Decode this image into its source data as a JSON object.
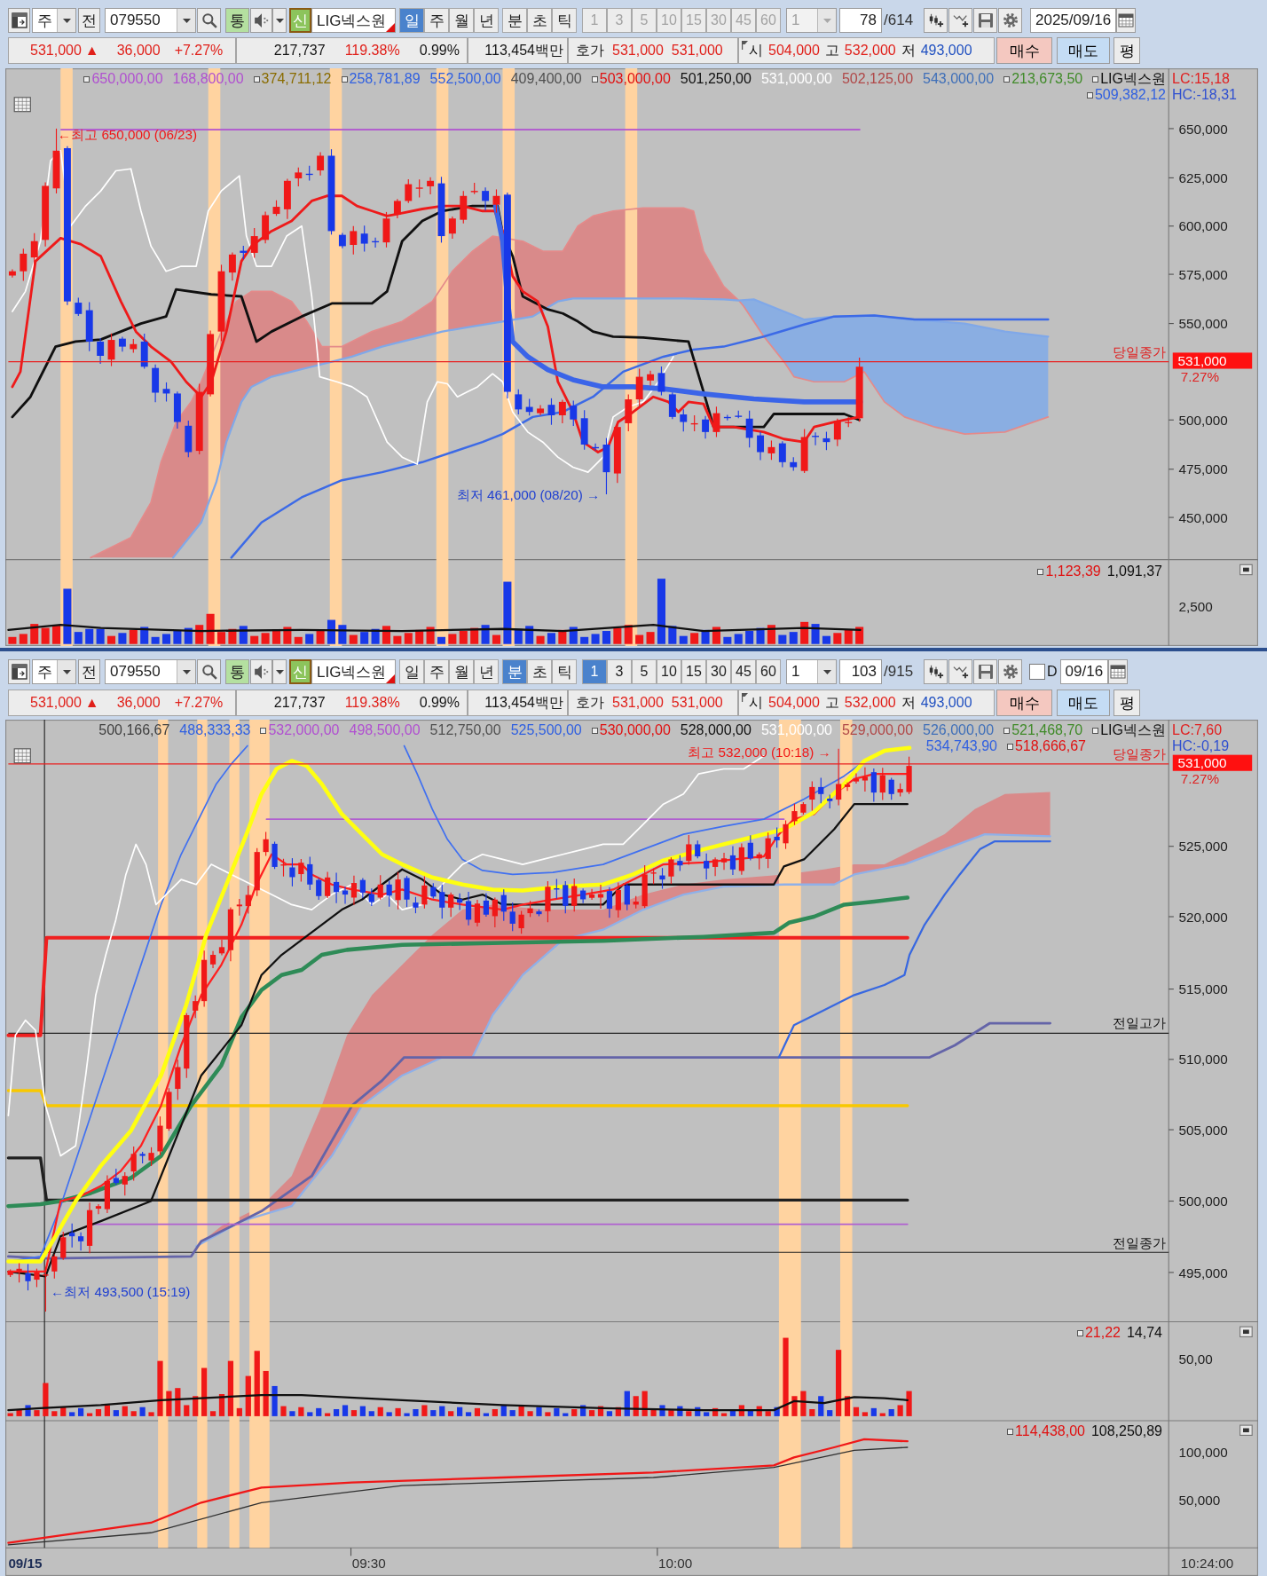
{
  "panels": [
    {
      "toolbar": {
        "unit": "주",
        "prev": "전",
        "code": "079550",
        "volume": "통",
        "credit": "신",
        "name": "LIG넥스원",
        "periods": [
          {
            "label": "일",
            "selected": true
          },
          {
            "label": "주",
            "selected": false
          },
          {
            "label": "월",
            "selected": false
          },
          {
            "label": "년",
            "selected": false
          }
        ],
        "intervals": [
          {
            "label": "분",
            "selected": false
          },
          {
            "label": "초",
            "selected": false
          },
          {
            "label": "틱",
            "selected": false
          }
        ],
        "steps": [
          {
            "label": "1",
            "selected": false,
            "disabled": true
          },
          {
            "label": "3",
            "selected": false,
            "disabled": true
          },
          {
            "label": "5",
            "selected": false,
            "disabled": true
          },
          {
            "label": "10",
            "selected": false,
            "disabled": true
          },
          {
            "label": "15",
            "selected": false,
            "disabled": true
          },
          {
            "label": "30",
            "selected": false,
            "disabled": true
          },
          {
            "label": "45",
            "selected": false,
            "disabled": true
          },
          {
            "label": "60",
            "selected": false,
            "disabled": true
          }
        ],
        "multiplier": {
          "value": "1",
          "disabled": true
        },
        "count": "78",
        "total": "/614",
        "date": "2025/09/16"
      },
      "quote": {
        "price": "531,000",
        "arrow": "▲",
        "change": "36,000",
        "rate": "+7.27%",
        "volume": "217,737",
        "volume_rate": "119.38%",
        "turnover": "0.99%",
        "amount": "113,454백만",
        "ask_label": "호가",
        "ask": "531,000",
        "bid": "531,000",
        "open_label": "시",
        "open": "504,000",
        "high_label": "고",
        "high": "532,000",
        "low_label": "저",
        "low": "493,000",
        "buy": "매수",
        "sell": "매도",
        "avg": "평"
      },
      "chart": {
        "kind": "daily",
        "legend": {
          "lines": [
            {
              "items": [
                {
                  "text": "650,000,00",
                  "color": "#b050d0",
                  "marker": true
                },
                {
                  "text": "168,800,00",
                  "color": "#b050d0",
                  "marker": false
                },
                {
                  "text": "374,711,12",
                  "color": "#8a6c00",
                  "marker": true
                },
                {
                  "text": "258,781,89",
                  "color": "#3060e0",
                  "marker": true
                },
                {
                  "text": "552,500,00",
                  "color": "#3060e0",
                  "marker": false
                },
                {
                  "text": "409,400,00",
                  "color": "#505050",
                  "marker": false
                },
                {
                  "text": "503,000,00",
                  "color": "#e01010",
                  "marker": true
                },
                {
                  "text": "501,250,00",
                  "color": "#101010",
                  "marker": false
                },
                {
                  "text": "531,000,00",
                  "color": "#ffffff",
                  "marker": false
                },
                {
                  "text": "502,125,00",
                  "color": "#b04848",
                  "marker": false
                },
                {
                  "text": "543,000,00",
                  "color": "#3f6fb8",
                  "marker": false
                },
                {
                  "text": "213,673,50",
                  "color": "#3f8a28",
                  "marker": true
                },
                {
                  "text": "LIG넥스원",
                  "color": "#101010",
                  "marker": true
                }
              ]
            },
            {
              "items": [
                {
                  "text": "509,382,12",
                  "color": "#3060e0",
                  "marker": true
                }
              ]
            }
          ],
          "lc": "LC:15,18",
          "hc": "HC:-18,31"
        },
        "price_axis": [
          "650,000",
          "625,000",
          "600,000",
          "575,000",
          "550,000",
          "500,000",
          "475,000",
          "450,000"
        ],
        "close": {
          "label": "당일종가",
          "price": "531,000",
          "rate": "7.27%"
        },
        "annotations": [
          {
            "kind": "high",
            "text": "←최고 650,000 (06/23)"
          },
          {
            "kind": "low",
            "text": "최저 461,000 (08/20) →"
          }
        ],
        "panes": [
          {
            "legend": [
              {
                "text": "1,123,39",
                "color": "#e01010",
                "marker": true
              },
              {
                "text": "1,091,37",
                "color": "#101010",
                "marker": false
              }
            ],
            "axis": [
              "2,500"
            ]
          }
        ]
      }
    },
    {
      "toolbar": {
        "unit": "주",
        "prev": "전",
        "code": "079550",
        "volume": "통",
        "credit": "신",
        "name": "LIG넥스원",
        "periods": [
          {
            "label": "일",
            "selected": false
          },
          {
            "label": "주",
            "selected": false
          },
          {
            "label": "월",
            "selected": false
          },
          {
            "label": "년",
            "selected": false
          }
        ],
        "intervals": [
          {
            "label": "분",
            "selected": true
          },
          {
            "label": "초",
            "selected": false
          },
          {
            "label": "틱",
            "selected": false
          }
        ],
        "steps": [
          {
            "label": "1",
            "selected": true,
            "disabled": false
          },
          {
            "label": "3",
            "selected": false,
            "disabled": false
          },
          {
            "label": "5",
            "selected": false,
            "disabled": false
          },
          {
            "label": "10",
            "selected": false,
            "disabled": false
          },
          {
            "label": "15",
            "selected": false,
            "disabled": false
          },
          {
            "label": "30",
            "selected": false,
            "disabled": false
          },
          {
            "label": "45",
            "selected": false,
            "disabled": false
          },
          {
            "label": "60",
            "selected": false,
            "disabled": false
          }
        ],
        "multiplier": {
          "value": "1",
          "disabled": false
        },
        "count": "103",
        "total": "/915",
        "date_filter": {
          "label": "D",
          "checked": false
        },
        "date": "09/16"
      },
      "quote": {
        "price": "531,000",
        "arrow": "▲",
        "change": "36,000",
        "rate": "+7.27%",
        "volume": "217,737",
        "volume_rate": "119.38%",
        "turnover": "0.99%",
        "amount": "113,454백만",
        "ask_label": "호가",
        "ask": "531,000",
        "bid": "531,000",
        "open_label": "시",
        "open": "504,000",
        "high_label": "고",
        "high": "532,000",
        "low_label": "저",
        "low": "493,000",
        "buy": "매수",
        "sell": "매도",
        "avg": "평"
      },
      "chart": {
        "kind": "intraday",
        "legend": {
          "lines": [
            {
              "items": [
                {
                  "text": "500,166,67",
                  "color": "#404040",
                  "marker": false
                },
                {
                  "text": "488,333,33",
                  "color": "#3060e0",
                  "marker": false
                },
                {
                  "text": "532,000,00",
                  "color": "#b050d0",
                  "marker": true
                },
                {
                  "text": "498,500,00",
                  "color": "#b050d0",
                  "marker": false
                },
                {
                  "text": "512,750,00",
                  "color": "#505050",
                  "marker": false
                },
                {
                  "text": "525,500,00",
                  "color": "#3060e0",
                  "marker": false
                },
                {
                  "text": "530,000,00",
                  "color": "#e01010",
                  "marker": true
                },
                {
                  "text": "528,000,00",
                  "color": "#101010",
                  "marker": false
                },
                {
                  "text": "531,000,00",
                  "color": "#ffffff",
                  "marker": false
                },
                {
                  "text": "529,000,00",
                  "color": "#b04848",
                  "marker": false
                },
                {
                  "text": "526,000,00",
                  "color": "#3f6fb8",
                  "marker": false
                },
                {
                  "text": "521,468,70",
                  "color": "#3f8a28",
                  "marker": true
                },
                {
                  "text": "LIG넥스원",
                  "color": "#101010",
                  "marker": true
                }
              ]
            },
            {
              "items": [
                {
                  "text": "534,743,90",
                  "color": "#3060e0",
                  "marker": false
                },
                {
                  "text": "518,666,67",
                  "color": "#e01010",
                  "marker": true
                }
              ]
            }
          ],
          "lc": "LC:7,60",
          "hc": "HC:-0,19"
        },
        "price_axis": [
          "525,000",
          "520,000",
          "515,000",
          "510,000",
          "505,000",
          "500,000",
          "495,000"
        ],
        "close": {
          "label": "당일종가",
          "price": "531,000",
          "rate": "7.27%"
        },
        "reference_lines": [
          {
            "label": "전일고가"
          },
          {
            "label": "전일종가"
          }
        ],
        "annotations": [
          {
            "kind": "high",
            "text": "최고 532,000 (10:18) →"
          },
          {
            "kind": "low",
            "text": "←최저 493,500 (15:19)"
          }
        ],
        "panes": [
          {
            "legend": [
              {
                "text": "21,22",
                "color": "#e01010",
                "marker": true
              },
              {
                "text": "14,74",
                "color": "#101010",
                "marker": false
              }
            ],
            "axis": [
              "50,00"
            ]
          },
          {
            "legend": [
              {
                "text": "114,438,00",
                "color": "#e01010",
                "marker": true
              },
              {
                "text": "108,250,89",
                "color": "#101010",
                "marker": false
              }
            ],
            "axis": [
              "100,000",
              "50,000"
            ]
          }
        ],
        "time_axis": [
          "09/15",
          "09:30",
          "10:00",
          "10:24:00"
        ]
      }
    }
  ]
}
